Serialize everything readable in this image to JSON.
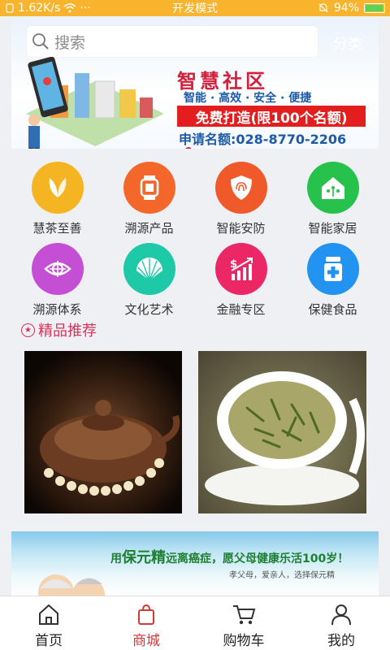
{
  "status_bar": {
    "speed": "1.62K/s",
    "more": "···",
    "mode": "开发模式",
    "battery": "94%",
    "battery_level": 0.94
  },
  "banner": {
    "title": "智慧社区",
    "tagline": "智能 · 高效 · 安全 · 便捷",
    "offer": "免费打造(限100个名额)",
    "phone": "申请名额:028-8770-2206"
  },
  "search": {
    "placeholder": "搜索",
    "category_label": "分类"
  },
  "categories": [
    {
      "label": "慧茶至善",
      "color": "#f5b422",
      "icon": "tea-leaf-icon"
    },
    {
      "label": "溯源产品",
      "color": "#f3672a",
      "icon": "smartwatch-icon"
    },
    {
      "label": "智能安防",
      "color": "#f05a2b",
      "icon": "fingerprint-shield-icon"
    },
    {
      "label": "智能家居",
      "color": "#27c24c",
      "icon": "smart-home-icon"
    },
    {
      "label": "溯源体系",
      "color": "#c44fd4",
      "icon": "eye-target-icon"
    },
    {
      "label": "文化艺术",
      "color": "#1dc9a7",
      "icon": "fan-icon"
    },
    {
      "label": "金融专区",
      "color": "#ec2766",
      "icon": "finance-growth-icon"
    },
    {
      "label": "保健食品",
      "color": "#2293f0",
      "icon": "medicine-jar-icon"
    }
  ],
  "recommend": {
    "title": "精品推荐"
  },
  "ad": {
    "prefix": "用",
    "brand": "保元精",
    "rest": "远离癌症，愿父母健康乐活100岁！",
    "sub": "孝父母，爱亲人，选择保元精"
  },
  "nav": [
    {
      "label": "首页",
      "icon": "home-icon",
      "active": false
    },
    {
      "label": "商城",
      "icon": "shopping-bag-icon",
      "active": true
    },
    {
      "label": "购物车",
      "icon": "cart-icon",
      "active": false
    },
    {
      "label": "我的",
      "icon": "user-icon",
      "active": false
    }
  ],
  "colors": {
    "status_bar": "#f7b42c",
    "accent_red": "#d23a3a",
    "background": "#eef0f3"
  }
}
